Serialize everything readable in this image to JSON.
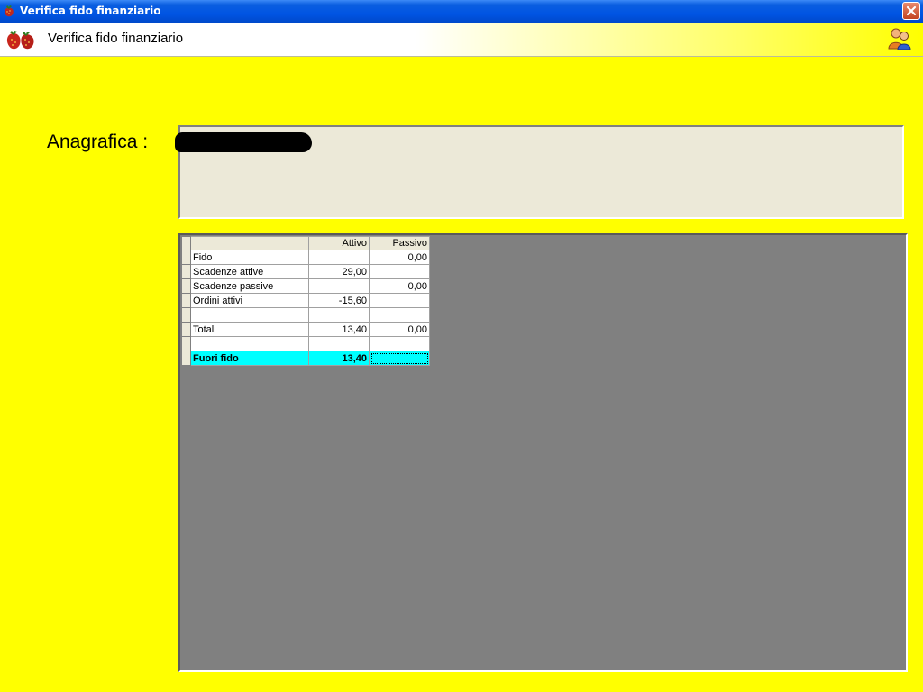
{
  "window": {
    "title": "Verifica fido finanziario"
  },
  "header": {
    "title": "Verifica fido finanziario"
  },
  "anagrafica": {
    "label": "Anagrafica :"
  },
  "grid": {
    "columns": [
      "",
      "Attivo",
      "Passivo"
    ],
    "rows": [
      {
        "label": "Fido",
        "attivo": "",
        "passivo": "0,00"
      },
      {
        "label": "Scadenze attive",
        "attivo": "29,00",
        "passivo": ""
      },
      {
        "label": "Scadenze passive",
        "attivo": "",
        "passivo": "0,00"
      },
      {
        "label": "Ordini attivi",
        "attivo": "-15,60",
        "passivo": ""
      },
      {
        "label": "",
        "attivo": "",
        "passivo": ""
      },
      {
        "label": "Totali",
        "attivo": "13,40",
        "passivo": "0,00"
      },
      {
        "label": "",
        "attivo": "",
        "passivo": ""
      },
      {
        "label": "Fuori fido",
        "attivo": "13,40",
        "passivo": ""
      }
    ]
  },
  "colors": {
    "background": "#ffff00",
    "highlight": "#00ffff",
    "grid_area": "#808080"
  },
  "icons": {
    "app": "strawberry-icon",
    "header": "strawberries-icon",
    "users": "users-icon",
    "close": "close-icon"
  }
}
